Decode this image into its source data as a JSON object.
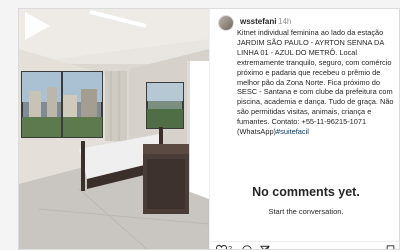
{
  "post": {
    "username": "wsstefani",
    "timestamp": "14h",
    "caption_text": "Kitnet individual feminina ao lado da estação JARDIM SÃO PAULO - AYRTON SENNA DA LINHA 01 - AZUL DO METRÔ. Local extremamente tranquilo, seguro, com comércio próximo e padaria que recebeu o prêmio de melhor pão da Zona Norte. Fica próximo do SESC - Santana e com clube da prefeitura com piscina, academia e dança. Tudo de graça. Não são permitidas visitas, animais, criança e fumantes. Contato: +55-11-96215-1071 (WhatsApp)",
    "hashtag": "#suitefacil",
    "like_count": "2"
  },
  "comments": {
    "empty_title": "No comments yet.",
    "empty_subtitle": "Start the conversation."
  },
  "icons": {
    "media_overlay": "play-icon",
    "actions": [
      "heart-icon",
      "comment-icon",
      "share-icon",
      "bookmark-icon"
    ]
  },
  "colors": {
    "text": "#262626",
    "secondary": "#8e8e8e",
    "hashtag": "#00376b",
    "border": "#dbdbdb"
  }
}
